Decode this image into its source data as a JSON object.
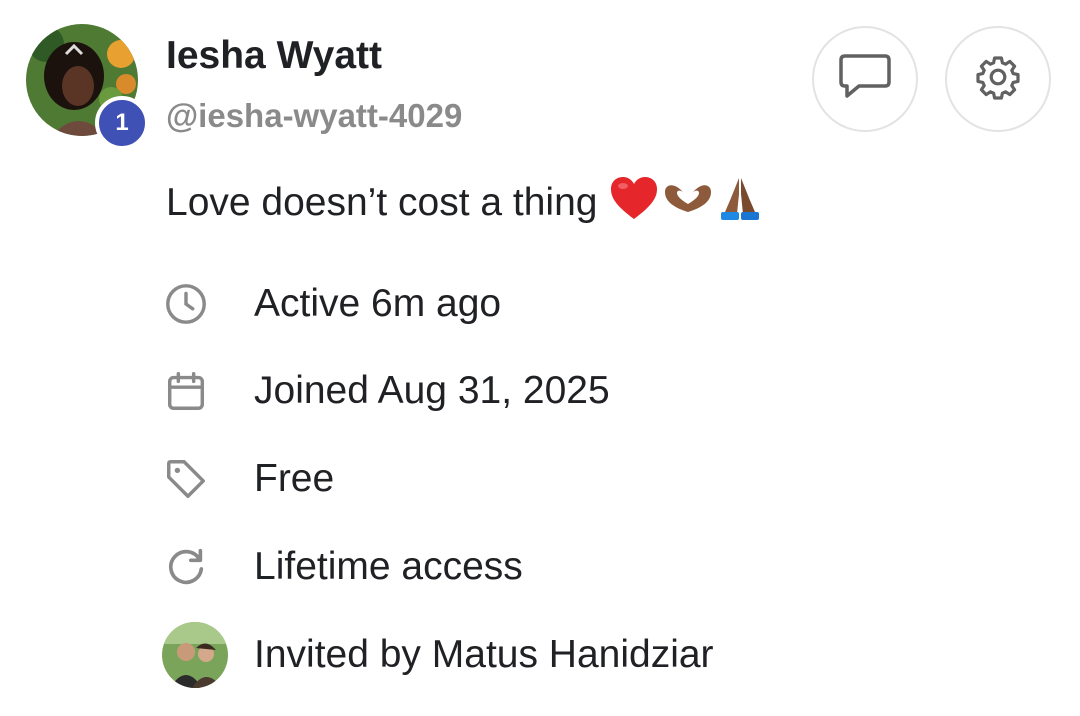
{
  "profile": {
    "name": "Iesha Wyatt",
    "handle": "@iesha-wyatt-4029",
    "level": "1",
    "bio": "Love doesn’t cost a thing",
    "bio_emojis": [
      "red-heart",
      "heart-hands",
      "folded-hands"
    ]
  },
  "actions": {
    "message_icon": "chat-bubble-icon",
    "settings_icon": "gear-icon"
  },
  "details": {
    "active": {
      "icon": "clock-icon",
      "text": "Active 6m ago"
    },
    "joined": {
      "icon": "calendar-icon",
      "text": "Joined Aug 31, 2025"
    },
    "plan": {
      "icon": "tag-icon",
      "text": "Free"
    },
    "access": {
      "icon": "refresh-icon",
      "text": "Lifetime access"
    },
    "invited": {
      "icon": "inviter-avatar",
      "text": "Invited by Matus Hanidziar"
    }
  },
  "colors": {
    "badge": "#3f51b5",
    "text": "#202124",
    "muted": "#8a8a8a",
    "icon": "#8a8a8a",
    "border": "#e3e3e3"
  }
}
